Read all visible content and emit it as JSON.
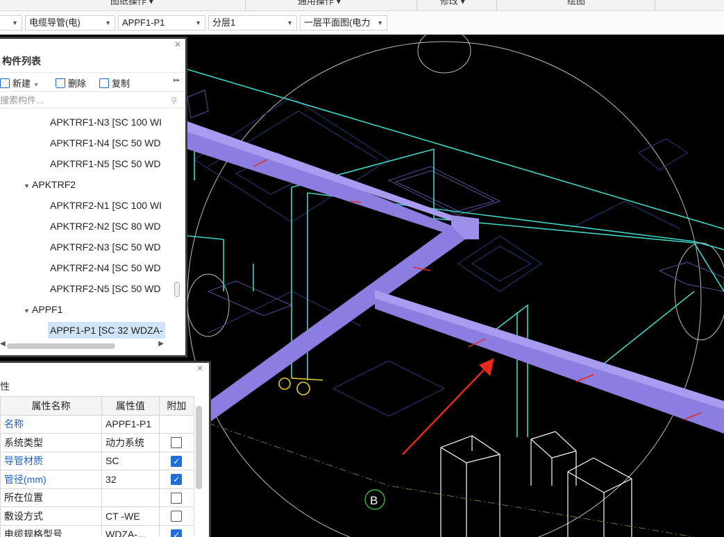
{
  "ribbon": {
    "groups": [
      "图纸操作 ▾",
      "通用操作 ▾",
      "修改 ▾",
      "绘图"
    ]
  },
  "toolbar": {
    "dropdown_0": "",
    "dropdown_1": "电缆导管(电)",
    "dropdown_2": "APPF1-P1",
    "dropdown_3": "分层1",
    "dropdown_4": "一层平面图(电力"
  },
  "component_list": {
    "title": "构件列表",
    "new_label": "新建",
    "delete_label": "删除",
    "copy_label": "复制",
    "search_placeholder": "搜索构件...",
    "items": [
      {
        "label": "APKTRF1-N3 [SC 100 WI",
        "level": 2
      },
      {
        "label": "APKTRF1-N4 [SC 50 WD",
        "level": 2
      },
      {
        "label": "APKTRF1-N5 [SC 50 WD",
        "level": 2
      },
      {
        "label": "APKTRF2",
        "level": 1
      },
      {
        "label": "APKTRF2-N1 [SC 100 WI",
        "level": 2
      },
      {
        "label": "APKTRF2-N2 [SC 80 WD",
        "level": 2
      },
      {
        "label": "APKTRF2-N3 [SC 50 WD",
        "level": 2
      },
      {
        "label": "APKTRF2-N4 [SC 50 WD",
        "level": 2
      },
      {
        "label": "APKTRF2-N5 [SC 50 WD",
        "level": 2
      },
      {
        "label": "APPF1",
        "level": 1
      },
      {
        "label": "APPF1-P1 [SC 32 WDZA-",
        "level": 2,
        "selected": true
      }
    ]
  },
  "properties": {
    "title": "性",
    "headers": [
      "属性名称",
      "属性值",
      "附加"
    ],
    "rows": [
      {
        "name": "名称",
        "value": "APPF1-P1",
        "checkbox": "none",
        "highlight": true
      },
      {
        "name": "系统类型",
        "value": "动力系统",
        "checkbox": "off",
        "highlight": false
      },
      {
        "name": "导管材质",
        "value": "SC",
        "checkbox": "on",
        "highlight": true
      },
      {
        "name": "管径(mm)",
        "value": "32",
        "checkbox": "on",
        "highlight": true
      },
      {
        "name": "所在位置",
        "value": "",
        "checkbox": "off",
        "highlight": false
      },
      {
        "name": "敷设方式",
        "value": "CT -WE",
        "checkbox": "off",
        "highlight": false
      },
      {
        "name": "电缆规格型号",
        "value": "WDZA-...",
        "checkbox": "on",
        "highlight": false
      }
    ]
  },
  "viewport": {
    "axis_label": "B",
    "conduit_color": "#8c7ee0",
    "cyan_color": "#3fd6c8",
    "arrow_color": "#e8281e"
  }
}
